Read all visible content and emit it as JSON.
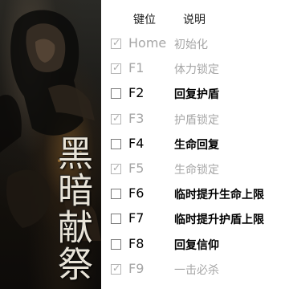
{
  "header": {
    "key_label": "键位",
    "desc_label": "说明"
  },
  "art": {
    "title": "黑暗献祭"
  },
  "rows": [
    {
      "key": "Home",
      "desc": "初始化",
      "checked": true,
      "disabled": true
    },
    {
      "key": "F1",
      "desc": "体力锁定",
      "checked": true,
      "disabled": true
    },
    {
      "key": "F2",
      "desc": "回复护盾",
      "checked": false,
      "disabled": false
    },
    {
      "key": "F3",
      "desc": "护盾锁定",
      "checked": true,
      "disabled": true
    },
    {
      "key": "F4",
      "desc": "生命回复",
      "checked": false,
      "disabled": false
    },
    {
      "key": "F5",
      "desc": "生命锁定",
      "checked": true,
      "disabled": true
    },
    {
      "key": "F6",
      "desc": "临时提升生命上限",
      "checked": false,
      "disabled": false
    },
    {
      "key": "F7",
      "desc": "临时提升护盾上限",
      "checked": false,
      "disabled": false
    },
    {
      "key": "F8",
      "desc": "回复信仰",
      "checked": false,
      "disabled": false
    },
    {
      "key": "F9",
      "desc": "一击必杀",
      "checked": true,
      "disabled": true
    }
  ]
}
